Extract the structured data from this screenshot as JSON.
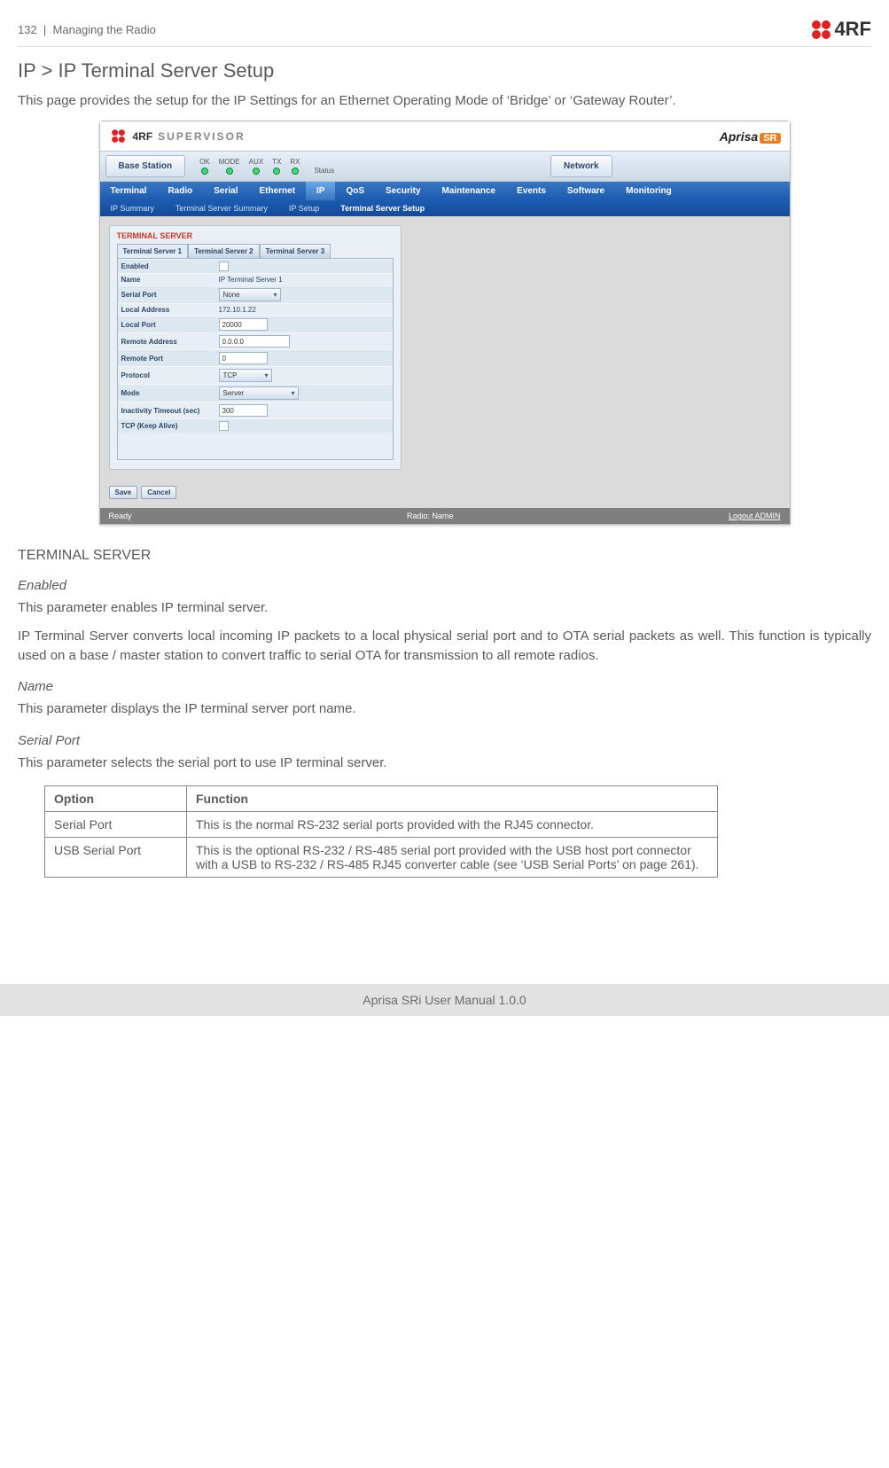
{
  "header": {
    "page_number": "132",
    "section": "Managing the Radio",
    "brand": "4RF"
  },
  "page": {
    "heading": "IP > IP Terminal Server Setup",
    "intro": "This page provides the setup for the IP Settings for an Ethernet Operating Mode of ‘Bridge’ or ‘Gateway Router’."
  },
  "shot": {
    "supervisor": "SUPERVISOR",
    "aprisa": "Aprisa",
    "aprisa_badge": "SR",
    "status_tabs": {
      "left": "Base Station",
      "right": "Network"
    },
    "leds": [
      "OK",
      "MODE",
      "AUX",
      "TX",
      "RX"
    ],
    "status_label": "Status",
    "nav1": [
      "Terminal",
      "Radio",
      "Serial",
      "Ethernet",
      "IP",
      "QoS",
      "Security",
      "Maintenance",
      "Events",
      "Software",
      "Monitoring"
    ],
    "nav1_active_index": 4,
    "nav2": [
      "IP Summary",
      "Terminal Server Summary",
      "IP Setup",
      "Terminal Server Setup"
    ],
    "nav2_active_index": 3,
    "panel_title": "TERMINAL SERVER",
    "ts_tabs": [
      "Terminal Server 1",
      "Terminal Server 2",
      "Terminal Server 3"
    ],
    "fields": {
      "enabled": {
        "label": "Enabled",
        "checked": false
      },
      "name": {
        "label": "Name",
        "value": "IP Terminal Server 1"
      },
      "serial_port": {
        "label": "Serial Port",
        "value": "None"
      },
      "local_address": {
        "label": "Local Address",
        "value": "172.10.1.22"
      },
      "local_port": {
        "label": "Local Port",
        "value": "20000"
      },
      "remote_address": {
        "label": "Remote Address",
        "value": "0.0.0.0"
      },
      "remote_port": {
        "label": "Remote Port",
        "value": "0"
      },
      "protocol": {
        "label": "Protocol",
        "value": "TCP"
      },
      "mode": {
        "label": "Mode",
        "value": "Server"
      },
      "inactivity": {
        "label": "Inactivity Timeout (sec)",
        "value": "300"
      },
      "keepalive": {
        "label": "TCP (Keep Alive)",
        "checked": false
      }
    },
    "buttons": {
      "save": "Save",
      "cancel": "Cancel"
    },
    "footer": {
      "ready": "Ready",
      "radio": "Radio: Name",
      "logout": "Logout ADMIN"
    }
  },
  "sections": {
    "terminal_server": "TERMINAL SERVER",
    "enabled_h": "Enabled",
    "enabled_p1": "This parameter enables IP terminal server.",
    "enabled_p2": "IP Terminal Server converts local incoming IP packets to a local physical serial port and to OTA serial packets as well. This function is typically used on a base / master station to convert traffic to serial OTA for transmission to all remote radios.",
    "name_h": "Name",
    "name_p": "This parameter displays the IP terminal server port name.",
    "serial_h": "Serial Port",
    "serial_p": "This parameter selects the serial port to use IP terminal server.",
    "table": {
      "head": {
        "c1": "Option",
        "c2": "Function"
      },
      "rows": [
        {
          "c1": "Serial Port",
          "c2": "This is the normal RS-232 serial ports provided with the RJ45 connector."
        },
        {
          "c1": "USB Serial Port",
          "c2": "This is the optional RS-232 / RS-485 serial port provided with the USB host port connector with a USB to RS-232 / RS-485 RJ45 converter cable (see ‘USB Serial Ports’ on page 261)."
        }
      ]
    }
  },
  "footer": "Aprisa SRi User Manual 1.0.0"
}
